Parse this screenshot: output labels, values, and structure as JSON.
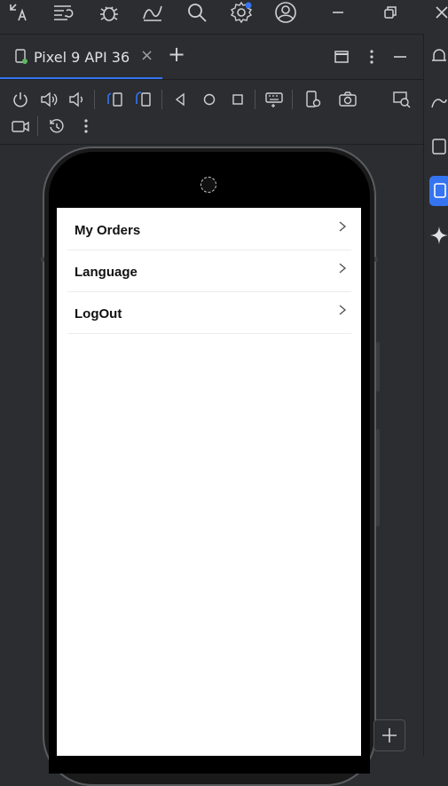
{
  "tab": {
    "label": "Pixel 9 API 36",
    "close_symbol": "×",
    "add_symbol": "+"
  },
  "toolbar_icons": [
    "translate-icon",
    "commit-icon",
    "debug-icon",
    "route-icon",
    "search-icon",
    "settings-icon",
    "account-icon",
    "minimize-icon",
    "restore-icon",
    "close-icon"
  ],
  "device_tools": [
    "power-icon",
    "volume-up-icon",
    "volume-down-icon",
    "rotate-left-icon",
    "rotate-right-icon",
    "back-icon",
    "home-icon",
    "overview-icon",
    "keyboard-icon",
    "device-settings-icon",
    "camera-icon",
    "zoom-icon",
    "record-icon",
    "snapshot-icon",
    "more-icon"
  ],
  "app": {
    "menu": [
      {
        "label": "My Orders"
      },
      {
        "label": "Language"
      },
      {
        "label": "LogOut"
      }
    ]
  },
  "colors": {
    "accent": "#3574f0",
    "panel": "#2b2d30",
    "screen": "#ffffff"
  }
}
